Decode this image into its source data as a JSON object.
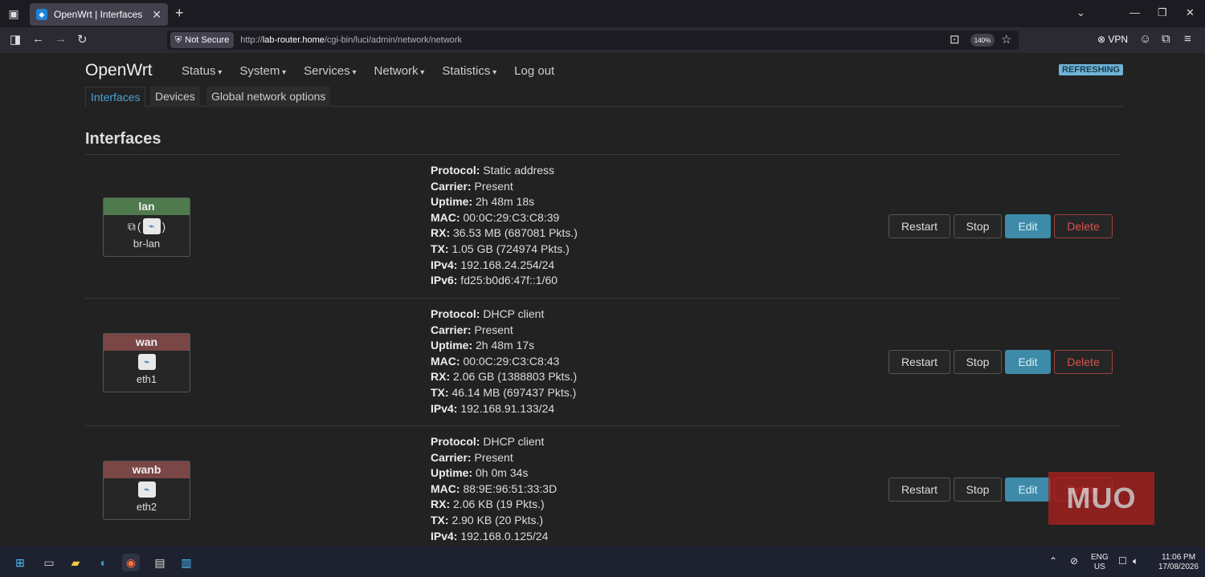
{
  "browser": {
    "tab_title": "OpenWrt | Interfaces",
    "new_tab": "+",
    "not_secure": "Not Secure",
    "url_prefix": "http://",
    "url_host": "lab-router.home",
    "url_path": "/cgi-bin/luci/admin/network/network",
    "zoom": "140%",
    "vpn": "VPN"
  },
  "header": {
    "brand": "OpenWrt",
    "menu": [
      "Status",
      "System",
      "Services",
      "Network",
      "Statistics",
      "Log out"
    ],
    "refreshing": "REFRESHING"
  },
  "subtabs": [
    "Interfaces",
    "Devices",
    "Global network options"
  ],
  "page_title": "Interfaces",
  "labels": {
    "protocol": "Protocol:",
    "carrier": "Carrier:",
    "uptime": "Uptime:",
    "mac": "MAC:",
    "rx": "RX:",
    "tx": "TX:",
    "ipv4": "IPv4:",
    "ipv6": "IPv6:"
  },
  "buttons": {
    "restart": "Restart",
    "stop": "Stop",
    "edit": "Edit",
    "delete": "Delete"
  },
  "interfaces": [
    {
      "name": "lan",
      "device": "br-lan",
      "protocol": "Static address",
      "carrier": "Present",
      "uptime": "2h 48m 18s",
      "mac": "00:0C:29:C3:C8:39",
      "rx": "36.53 MB (687081 Pkts.)",
      "tx": "1.05 GB (724974 Pkts.)",
      "ipv4": "192.168.24.254/24",
      "ipv6": "fd25:b0d6:47f::1/60"
    },
    {
      "name": "wan",
      "device": "eth1",
      "protocol": "DHCP client",
      "carrier": "Present",
      "uptime": "2h 48m 17s",
      "mac": "00:0C:29:C3:C8:43",
      "rx": "2.06 GB (1388803 Pkts.)",
      "tx": "46.14 MB (697437 Pkts.)",
      "ipv4": "192.168.91.133/24"
    },
    {
      "name": "wanb",
      "device": "eth2",
      "protocol": "DHCP client",
      "carrier": "Present",
      "uptime": "0h 0m 34s",
      "mac": "88:9E:96:51:33:3D",
      "rx": "2.06 KB (19 Pkts.)",
      "tx": "2.90 KB (20 Pkts.)",
      "ipv4": "192.168.0.125/24"
    }
  ],
  "watermark": "MUO",
  "taskbar": {
    "lang_top": "ENG",
    "lang_bottom": "US",
    "time": "11:06 PM",
    "date": "17/08/2026"
  }
}
